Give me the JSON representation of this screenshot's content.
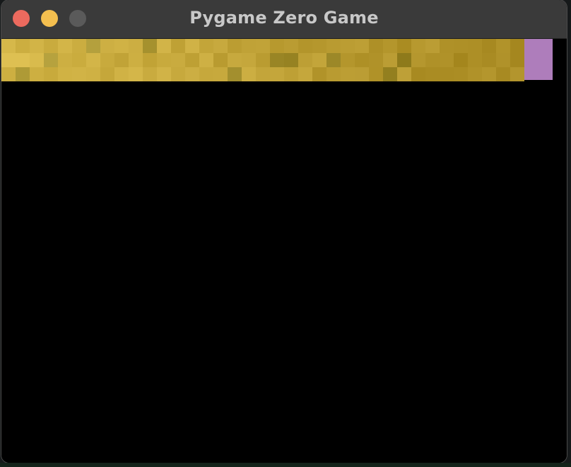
{
  "window": {
    "title": "Pygame Zero Game",
    "traffic_lights": [
      {
        "name": "close",
        "color": "#ec6a5e"
      },
      {
        "name": "minimize",
        "color": "#f4bf4f"
      },
      {
        "name": "zoom",
        "color": "#5a5a5a"
      }
    ]
  },
  "game": {
    "background": "#000000",
    "bar_colors": {
      "main_gradient_start": "#d6b84a",
      "main_gradient_end": "#aa8c24",
      "tail": "#ae7dbb"
    }
  }
}
